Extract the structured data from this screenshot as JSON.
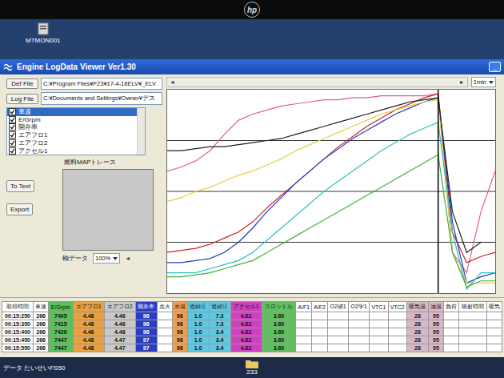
{
  "bezel": {
    "logo": "hp"
  },
  "desktop": {
    "icons": [
      {
        "label": "MTMON001"
      }
    ]
  },
  "window": {
    "title": "Engine LogData Viewer Ver1.30",
    "minimize": "_"
  },
  "files": [
    {
      "button": "Def File",
      "path": "C:¥Program Files¥F23¥17-4-18ELV¥_ELV"
    },
    {
      "button": "Log File",
      "path": "C:¥Documents and Settings¥Owner¥デス"
    }
  ],
  "channels": [
    {
      "label": "車速",
      "checked": true,
      "selected": true
    },
    {
      "label": "E/Grpm",
      "checked": true,
      "selected": false
    },
    {
      "label": "開弁率",
      "checked": true,
      "selected": false
    },
    {
      "label": "エアフロ1",
      "checked": true,
      "selected": false
    },
    {
      "label": "エアフロ2",
      "checked": true,
      "selected": false
    },
    {
      "label": "アクセル1",
      "checked": true,
      "selected": false
    }
  ],
  "fuel_map": {
    "title": "燃料MAPトレース"
  },
  "buttons": [
    "To Text",
    "Export"
  ],
  "axis": {
    "label": "軸データ",
    "zoom": "100%",
    "arrow": "◄"
  },
  "scrollbar": {
    "left": "◄",
    "right": "►"
  },
  "interval": "1min",
  "chart": {
    "cursor": 19,
    "grid": [
      25,
      50,
      75
    ],
    "series": [
      {
        "color": "#e06080",
        "values": [
          60,
          62,
          65,
          70,
          78,
          85,
          88,
          90,
          92,
          93,
          94,
          95,
          95,
          96,
          96,
          97,
          97,
          97,
          97,
          98,
          20,
          10,
          40,
          60
        ]
      },
      {
        "color": "#d02020",
        "values": [
          20,
          21,
          22,
          24,
          27,
          30,
          35,
          42,
          48,
          54,
          60,
          66,
          72,
          77,
          82,
          86,
          90,
          93,
          96,
          98,
          30,
          15,
          18,
          20
        ]
      },
      {
        "color": "#2040c0",
        "values": [
          15,
          15,
          16,
          17,
          20,
          25,
          32,
          40,
          47,
          54,
          60,
          66,
          71,
          76,
          80,
          84,
          88,
          91,
          94,
          96,
          35,
          5,
          8,
          10
        ]
      },
      {
        "color": "#e8d040",
        "values": [
          45,
          47,
          50,
          52,
          55,
          58,
          60,
          63,
          66,
          70,
          73,
          76,
          79,
          82,
          85,
          88,
          90,
          92,
          94,
          95,
          20,
          5,
          5,
          5
        ]
      },
      {
        "color": "#30c0c0",
        "values": [
          10,
          10,
          10,
          12,
          14,
          16,
          20,
          26,
          32,
          38,
          44,
          50,
          55,
          60,
          65,
          70,
          74,
          78,
          81,
          84,
          30,
          2,
          10,
          10
        ]
      },
      {
        "color": "#40b040",
        "values": [
          8,
          8,
          9,
          10,
          12,
          14,
          16,
          20,
          24,
          28,
          32,
          36,
          40,
          44,
          48,
          52,
          56,
          60,
          64,
          68,
          20,
          3,
          6,
          6
        ]
      },
      {
        "color": "#202020",
        "values": [
          70,
          70,
          71,
          72,
          72,
          73,
          74,
          75,
          76,
          78,
          80,
          82,
          84,
          86,
          88,
          90,
          92,
          94,
          95,
          96,
          40,
          20,
          25,
          25
        ]
      }
    ]
  },
  "table": {
    "columns": [
      {
        "label": "取得時間",
        "color": "#ffffff"
      },
      {
        "label": "車速",
        "color": "#ffffff"
      },
      {
        "label": "E/Grpm",
        "color": "#5bbf5b"
      },
      {
        "label": "エアフロ1",
        "color": "#e8a040"
      },
      {
        "label": "エアフロ2",
        "color": "#c8c8c8"
      },
      {
        "label": "開弁率",
        "color": "#2a3cc0"
      },
      {
        "label": "点火",
        "color": "#ffffff"
      },
      {
        "label": "水温",
        "color": "#f0a050"
      },
      {
        "label": "過給圧",
        "color": "#60c8e0"
      },
      {
        "label": "過給圧",
        "color": "#60c8e0"
      },
      {
        "label": "アクセル1",
        "color": "#d040c0"
      },
      {
        "label": "スロットル",
        "color": "#60c060"
      },
      {
        "label": "A/F1",
        "color": "#ffffff"
      },
      {
        "label": "A/F2",
        "color": "#ffffff"
      },
      {
        "label": "O2値1",
        "color": "#ffffff"
      },
      {
        "label": "O2学1",
        "color": "#ffffff"
      },
      {
        "label": "VTC1",
        "color": "#ffffff"
      },
      {
        "label": "VTC2",
        "color": "#ffffff"
      },
      {
        "label": "吸気温",
        "color": "#d8b8c8"
      },
      {
        "label": "油温",
        "color": "#d8b8c8"
      },
      {
        "label": "負荷",
        "color": "#ffffff"
      },
      {
        "label": "噴射時間",
        "color": "#ffffff"
      },
      {
        "label": "吸気",
        "color": "#ffffff"
      }
    ],
    "rows": [
      [
        "00:15:250",
        "266",
        "7405",
        "4.48",
        "4.46",
        "98",
        "",
        "98",
        "1.0",
        "7.3",
        "4.61",
        "3.60",
        "",
        "",
        "",
        "",
        "",
        "",
        "28",
        "95",
        "",
        "",
        ""
      ],
      [
        "00:15:350",
        "266",
        "7415",
        "4.48",
        "4.46",
        "98",
        "",
        "98",
        "1.0",
        "7.3",
        "4.61",
        "3.60",
        "",
        "",
        "",
        "",
        "",
        "",
        "28",
        "95",
        "",
        "",
        ""
      ],
      [
        "00:15:400",
        "266",
        "7426",
        "4.46",
        "4.48",
        "98",
        "",
        "98",
        "1.0",
        "3.4",
        "4.61",
        "3.60",
        "",
        "",
        "",
        "",
        "",
        "",
        "28",
        "95",
        "",
        "",
        ""
      ],
      [
        "00:15:450",
        "266",
        "7447",
        "4.48",
        "4.47",
        "97",
        "",
        "98",
        "1.0",
        "3.4",
        "4.61",
        "3.60",
        "",
        "",
        "",
        "",
        "",
        "",
        "28",
        "95",
        "",
        "",
        ""
      ],
      [
        "00:15:550",
        "266",
        "7447",
        "4.48",
        "4.47",
        "97",
        "",
        "98",
        "1.0",
        "3.4",
        "4.61",
        "3.60",
        "",
        "",
        "",
        "",
        "",
        "",
        "28",
        "95",
        "",
        "",
        ""
      ]
    ]
  },
  "taskbar": {
    "left": "データ たいせいFS50",
    "folder": "233"
  }
}
